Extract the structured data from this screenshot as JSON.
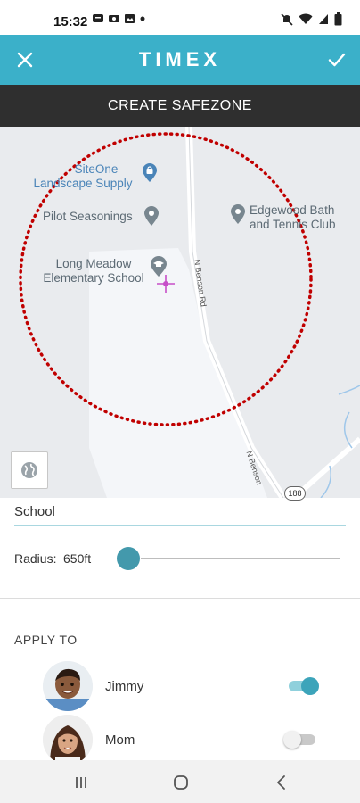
{
  "status_bar": {
    "time": "15:32",
    "left_icons": [
      "messages-icon",
      "screen-record-icon",
      "gallery-icon",
      "dot-icon"
    ],
    "right_icons": [
      "mute-icon",
      "wifi-icon",
      "signal-icon",
      "battery-icon"
    ]
  },
  "header": {
    "brand": "TIMEX",
    "close_icon": "close-icon",
    "confirm_icon": "check-icon",
    "background": "#3bb0c9"
  },
  "title_bar": {
    "title": "CREATE SAFEZONE",
    "background": "#2f2f2f"
  },
  "map": {
    "pois": [
      {
        "name": "SiteOne\nLandscape Supply",
        "icon": "shopping-bag-pin-icon"
      },
      {
        "name": "Pilot Seasonings",
        "icon": "location-pin-icon"
      },
      {
        "name": "Edgewood Bath\nand Tennis Club",
        "icon": "location-pin-icon"
      },
      {
        "name": "Long Meadow\nElementary School",
        "icon": "school-pin-icon"
      }
    ],
    "road_labels": [
      "N Benson Rd",
      "N Benson"
    ],
    "route_badge": "188",
    "zone_circle_color": "#c00000",
    "layers_icon": "globe-icon"
  },
  "form": {
    "zone_name_value": "School",
    "radius_label": "Radius:",
    "radius_value": "650ft",
    "radius_slider_fraction": 0.0,
    "accent": "#4399ac"
  },
  "apply_to": {
    "header": "APPLY TO",
    "people": [
      {
        "name": "Jimmy",
        "enabled": true
      },
      {
        "name": "Mom",
        "enabled": false
      }
    ]
  },
  "nav_bar": {
    "buttons": [
      "recent-apps-icon",
      "home-icon",
      "back-icon"
    ]
  }
}
